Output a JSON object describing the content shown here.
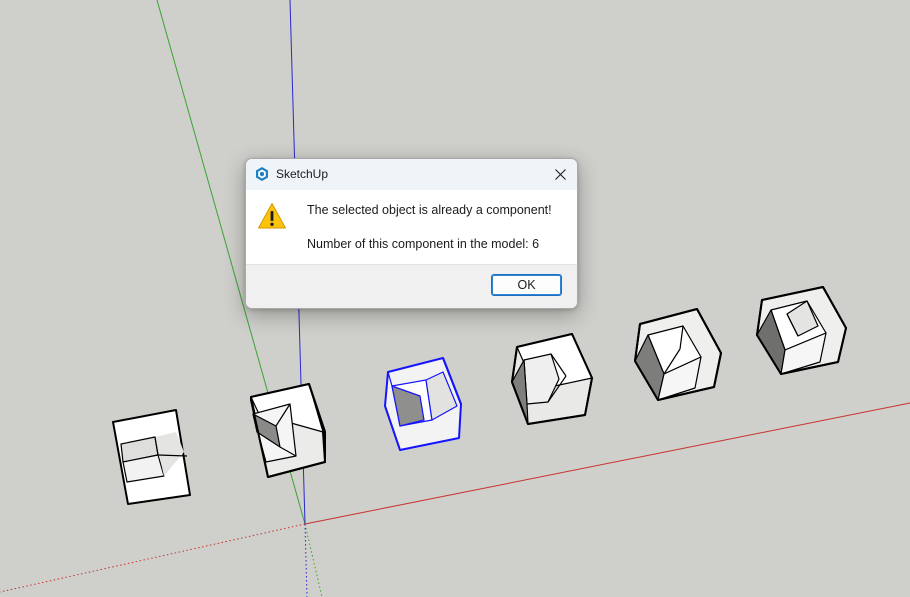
{
  "dialog": {
    "title": "SketchUp",
    "message": "The selected object is already a component!",
    "detail": "Number of this component in the model: 6",
    "ok_label": "OK",
    "icon": "warning-icon",
    "app_icon": "sketchup-logo-icon",
    "close_icon": "close-icon"
  },
  "scene": {
    "background_color": "#cfcfcb",
    "axis_colors": {
      "red": "#c8322d",
      "green": "#3aa434",
      "blue": "#2a2ad0"
    },
    "selection_color": "#1414ff",
    "component_count": 6,
    "selected_index": 2
  }
}
